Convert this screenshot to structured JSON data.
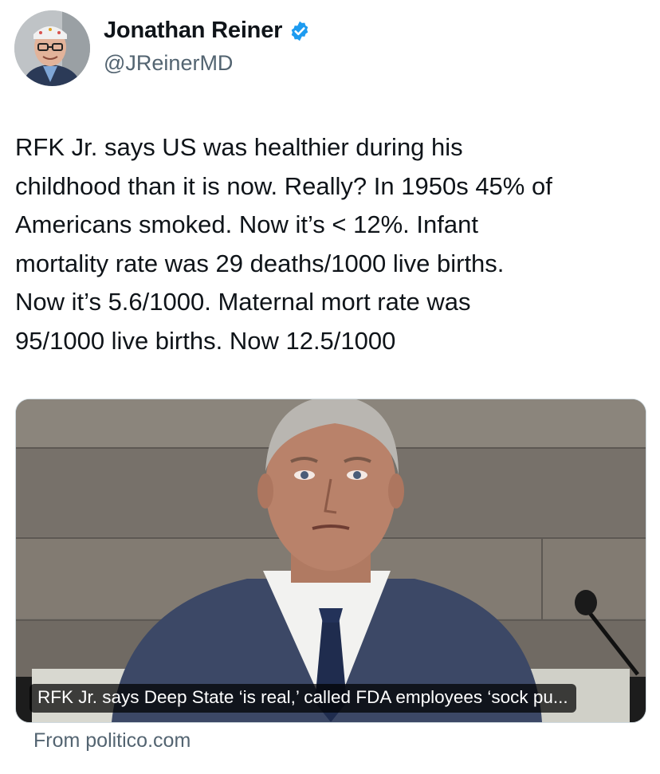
{
  "author": {
    "display_name": "Jonathan Reiner",
    "handle": "@JReinerMD",
    "verified": true,
    "verified_color": "#1d9bf0"
  },
  "tweet": {
    "text": "RFK Jr. says US was healthier during his\nchildhood than it is now. Really? In 1950s 45% of\nAmericans smoked. Now it’s < 12%. Infant\nmortality rate was 29 deaths/1000 live births.\nNow it’s 5.6/1000. Maternal mort rate was\n95/1000 live births. Now 12.5/1000"
  },
  "link_card": {
    "caption": "RFK Jr. says Deep State ‘is real,’ called FDA employees ‘sock pu...",
    "source": "From politico.com"
  }
}
